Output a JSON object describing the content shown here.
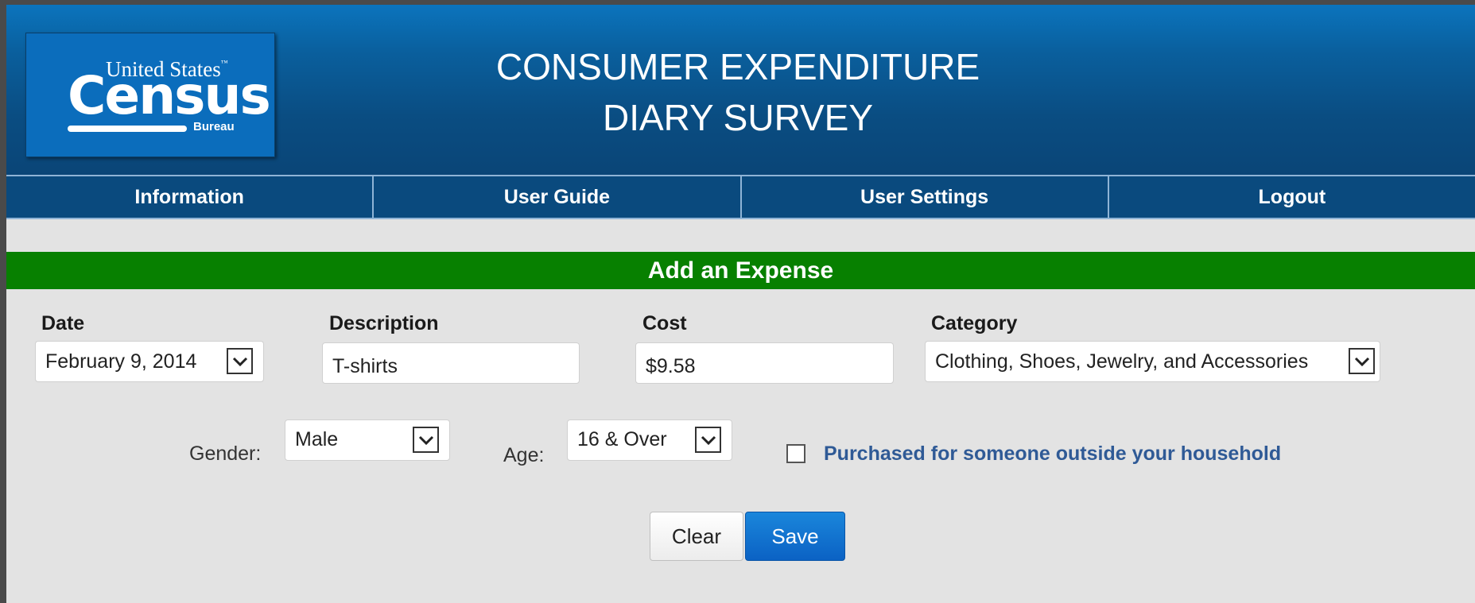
{
  "header": {
    "logo": {
      "line1": "United States",
      "tm": "™",
      "line2": "Census",
      "line3": "Bureau"
    },
    "title_line1": "CONSUMER EXPENDITURE",
    "title_line2": "DIARY SURVEY"
  },
  "nav": {
    "items": [
      {
        "label": "Information"
      },
      {
        "label": "User Guide"
      },
      {
        "label": "User Settings"
      },
      {
        "label": "Logout"
      }
    ]
  },
  "form": {
    "section_title": "Add an Expense",
    "date": {
      "label": "Date",
      "value": "February 9, 2014"
    },
    "description": {
      "label": "Description",
      "value": "T-shirts"
    },
    "cost": {
      "label": "Cost",
      "value": "$9.58"
    },
    "category": {
      "label": "Category",
      "value": "Clothing, Shoes, Jewelry, and Accessories"
    },
    "gender": {
      "label": "Gender:",
      "value": "Male"
    },
    "age": {
      "label": "Age:",
      "value": "16 & Over"
    },
    "outside_household": {
      "label": "Purchased for someone outside your household",
      "checked": false
    },
    "buttons": {
      "clear": "Clear",
      "save": "Save"
    }
  },
  "colors": {
    "header_blue": "#0a4d82",
    "section_green": "#078000",
    "save_blue": "#0b62c4",
    "link_blue": "#2f5a96"
  }
}
